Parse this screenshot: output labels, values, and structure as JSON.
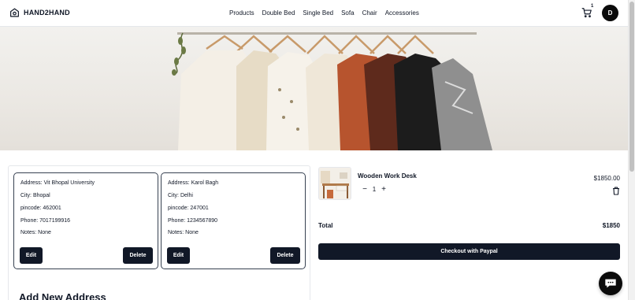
{
  "header": {
    "brand": "HAND2HAND",
    "nav": [
      "Products",
      "Double Bed",
      "Single Bed",
      "Sofa",
      "Chair",
      "Accessories"
    ],
    "cart_count": "1",
    "avatar_initial": "D"
  },
  "hero": {
    "icon": "clothes-rack-image"
  },
  "addresses": [
    {
      "address": "Address: Vit Bhopal University",
      "city": "City: Bhopal",
      "pincode": "pincode: 462001",
      "phone": "Phone: 7017199916",
      "notes": "Notes: None",
      "edit_label": "Edit",
      "delete_label": "Delete"
    },
    {
      "address": "Address: Karol Bagh",
      "city": "City: Delhi",
      "pincode": "pincode: 247001",
      "phone": "Phone: 1234567890",
      "notes": "Notes: None",
      "edit_label": "Edit",
      "delete_label": "Delete"
    }
  ],
  "add_address_heading": "Add New Address",
  "cart": {
    "item_name": "Wooden Work Desk",
    "quantity": "1",
    "price": "$1850.00",
    "total_label": "Total",
    "total_value": "$1850",
    "checkout_label": "Checkout with Paypal"
  },
  "colors": {
    "primary_dark": "#111827",
    "border": "#e5e7eb",
    "card_border": "#374151"
  }
}
